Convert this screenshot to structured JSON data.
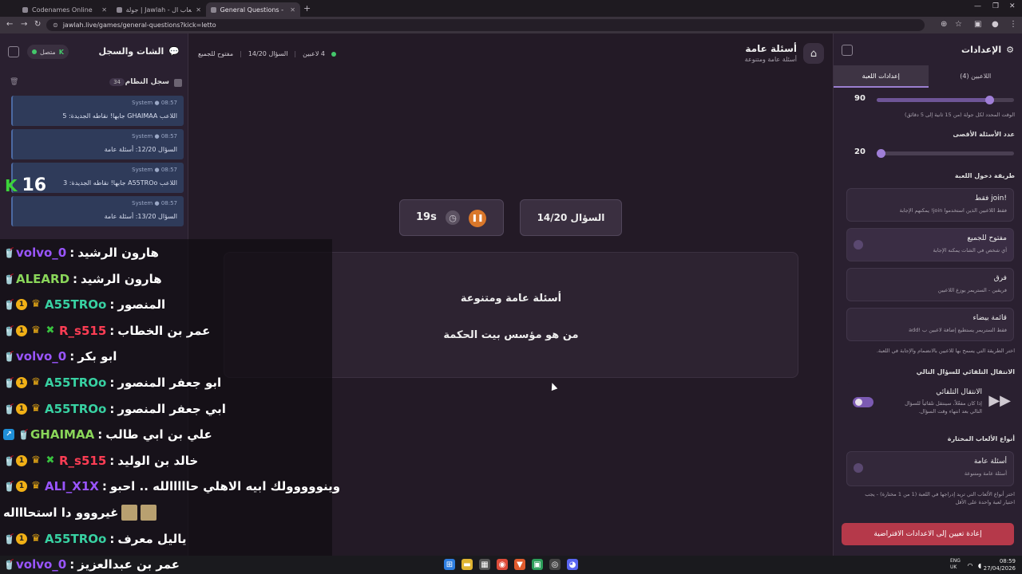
{
  "browser": {
    "tabs": [
      {
        "label": "Codenames Online",
        "active": false
      },
      {
        "label": "جولة | Jawlah - منصة الألعاب ال...",
        "active": false
      },
      {
        "label": "General Questions - أسئلة عامة",
        "active": true
      }
    ],
    "url": "jawlah.live/games/general-questions?kick=letto"
  },
  "chat_panel": {
    "title": "الشات والسجل",
    "status": "متصل",
    "syslog_label": "سجل النظام",
    "syslog_count": "34",
    "messages": [
      {
        "time": "08:57",
        "sender": "System",
        "text": "اللاعب GHAIMAA جابها! نقاطه الجديدة: 5"
      },
      {
        "time": "08:57",
        "sender": "System",
        "text": "السؤال 12/20: أسئلة عامة"
      },
      {
        "time": "08:57",
        "sender": "System",
        "text": "اللاعب A55TROo جابها! نقاطه الجديدة: 3"
      },
      {
        "time": "08:57",
        "sender": "System",
        "text": "السؤال 13/20: أسئلة عامة"
      }
    ],
    "big_count": "16"
  },
  "header": {
    "title": "أسئلة عامة",
    "subtitle": "أسئلة عامة ومتنوعة",
    "players": "4 لاعبين",
    "question_progress": "السؤال 14/20",
    "mode": "مفتوح للجميع"
  },
  "question": {
    "number_label": "السؤال 14/20",
    "timer": "19s",
    "category": "أسئلة عامة ومتنوعة",
    "text": "من هو مؤسس بيت الحكمة"
  },
  "settings": {
    "title": "الإعدادات",
    "tab_players": "اللاعبين (4)",
    "tab_game": "إعدادات اللعبة",
    "time_value": "90",
    "time_fraction": 0.82,
    "time_hint": "الوقت المحدد لكل جولة (من 15 ثانية إلى 5 دقائق)",
    "max_q_label": "عدد الأسئلة الأقصى",
    "max_q_value": "20",
    "max_q_fraction": 0.03,
    "entry_label": "طريقة دخول اللعبة",
    "options": [
      {
        "title": "!join فقط",
        "desc": "فقط اللاعبين الذين استخدموا join! يمكنهم الإجابة"
      },
      {
        "title": "مفتوح للجميع",
        "desc": "أي شخص في الشات يمكنه الإجابة",
        "selected": true
      },
      {
        "title": "فرق",
        "desc": "فريقين - الستريمر يوزع اللاعبين"
      },
      {
        "title": "قائمة بيضاء",
        "desc": "فقط الستريمر يستطيع إضافة لاعبين ب !add"
      }
    ],
    "entry_hint": "اختر الطريقة التي يسمح بها للاعبين بالانضمام والإجابة في اللعبة.",
    "auto_next_label": "الانتقال التلقائي للسؤال التالي",
    "auto_title": "الانتقال التلقائي",
    "auto_desc1": "إذا كان مفعّلاً، سينتقل تلقائياً للسؤال",
    "auto_desc2": "التالي بعد انتهاء وقت السؤال.",
    "types_label": "أنواع الألعاب المختارة",
    "type_title": "أسئلة عامة",
    "type_desc": "أسئلة عامة ومتنوعة",
    "types_hint1": "اختر أنواع الألعاب التي تريد إدراجها في اللعبة (1 من 1 مختارة) - يجب",
    "types_hint2": "اختيار لعبة واحدة على الأقل",
    "reset": "إعادة تعيين إلى الاعدادات الافتراضية"
  },
  "chat_overlay": [
    {
      "user": "volvo_0",
      "text": "هارون الرشيد",
      "color": "#9a55ff",
      "badges": [
        "cup"
      ]
    },
    {
      "user": "ALEARD",
      "text": "هارون الرشيد",
      "color": "#8ad65a",
      "badges": [
        "cup"
      ]
    },
    {
      "user": "A55TROo",
      "text": "المنصور",
      "color": "#38d1a2",
      "badges": [
        "cup",
        "one",
        "crown"
      ]
    },
    {
      "user": "R_s515",
      "text": "عمر بن الخطاب",
      "color": "#ff3d54",
      "badges": [
        "cup",
        "one",
        "crown",
        "mod"
      ]
    },
    {
      "user": "volvo_0",
      "text": "ابو بكر",
      "color": "#9a55ff",
      "badges": [
        "cup"
      ]
    },
    {
      "user": "A55TROo",
      "text": "ابو جعفر المنصور",
      "color": "#38d1a2",
      "badges": [
        "cup",
        "one",
        "crown"
      ]
    },
    {
      "user": "A55TROo",
      "text": "ابي جعفر المنصور",
      "color": "#38d1a2",
      "badges": [
        "cup",
        "one",
        "crown"
      ]
    },
    {
      "user": "GHAIMAA",
      "text": "علي بن ابي طالب",
      "color": "#8ad65a",
      "badges": [
        "blue",
        "cup"
      ]
    },
    {
      "user": "R_s515",
      "text": "خالد بن الوليد",
      "color": "#ff3d54",
      "badges": [
        "cup",
        "one",
        "crown",
        "mod"
      ]
    },
    {
      "user": "ALI_X1X",
      "text": "وينووووولك ابيه الاهلي حااااالله .. احبو",
      "color": "#9a55ff",
      "badges": [
        "cup",
        "one",
        "crown"
      ]
    },
    {
      "user": "",
      "text": "غيرووو دا استحاااله",
      "color": "#ffffff",
      "badges": []
    },
    {
      "user": "A55TROo",
      "text": "ياليل معرف",
      "color": "#38d1a2",
      "badges": [
        "cup",
        "one",
        "crown"
      ]
    },
    {
      "user": "volvo_0",
      "text": "عمر بن عبدالعزيز",
      "color": "#9a55ff",
      "badges": [
        "cup"
      ]
    }
  ],
  "taskbar": {
    "lang1": "ENG",
    "lang2": "UK",
    "time": "08:59",
    "date": "27/04/2026"
  }
}
